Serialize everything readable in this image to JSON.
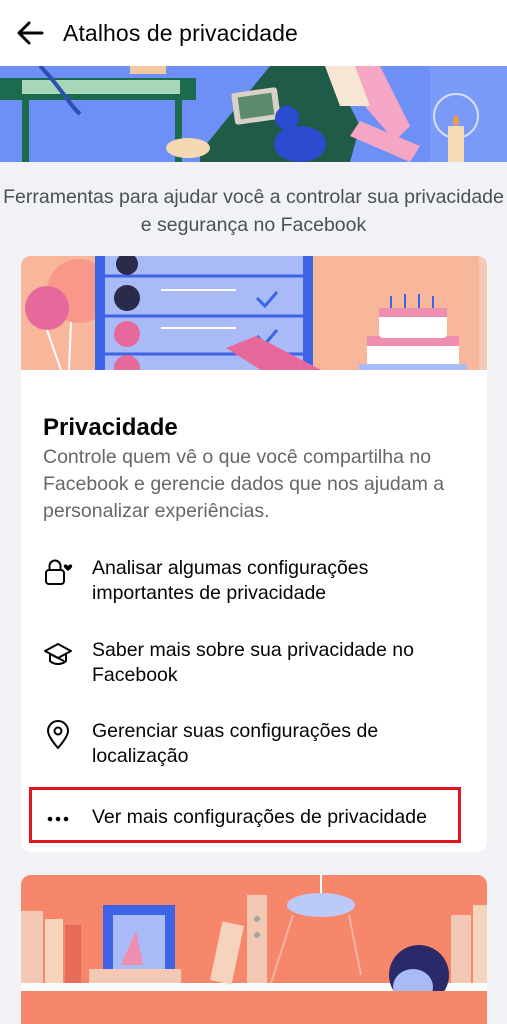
{
  "header": {
    "back_icon": "arrow-left-icon",
    "title": "Atalhos de privacidade"
  },
  "intro": {
    "text": "Ferramentas para ajudar você a controlar sua privacidade e segurança no Facebook"
  },
  "privacy_card": {
    "title": "Privacidade",
    "description": "Controle quem vê o que você compartilha no Facebook e gerencie dados que nos ajudam a personalizar experiências.",
    "options": [
      {
        "icon": "lock-heart-icon",
        "label": "Analisar algumas configurações importantes de privacidade"
      },
      {
        "icon": "graduation-cap-icon",
        "label": "Saber mais sobre sua privacidade no Facebook"
      },
      {
        "icon": "location-pin-icon",
        "label": "Gerenciar suas configurações de localização"
      },
      {
        "icon": "more-dots-icon",
        "label": "Ver mais configurações de privacidade"
      }
    ]
  },
  "colors": {
    "hero_bg": "#6e8ff5",
    "card_art_bg": "#f8b79b",
    "bottom_card_bg": "#f6876b",
    "highlight": "#e0161f"
  }
}
